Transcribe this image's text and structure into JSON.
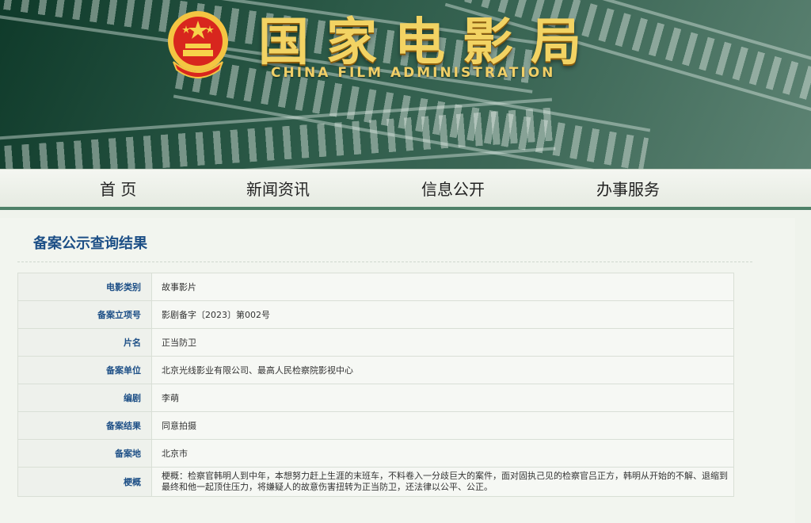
{
  "header": {
    "title": "国家电影局",
    "subtitle": "CHINA FILM ADMINISTRATION",
    "emblem": "national-emblem",
    "colors": {
      "bg_dark": "#0f3a2a",
      "bg_light": "#5d8373",
      "title_gold": "#f2d363"
    }
  },
  "nav": {
    "items": [
      {
        "label": "首 页"
      },
      {
        "label": "新闻资讯"
      },
      {
        "label": "信息公开"
      },
      {
        "label": "办事服务"
      }
    ],
    "accent": "#4e8068"
  },
  "result": {
    "title": "备案公示查询结果",
    "title_color": "#1d4f86",
    "rows": [
      {
        "label": "电影类别",
        "value": "故事影片"
      },
      {
        "label": "备案立项号",
        "value": "影剧备字〔2023〕第002号"
      },
      {
        "label": "片名",
        "value": "正当防卫"
      },
      {
        "label": "备案单位",
        "value": "北京光线影业有限公司、最高人民检察院影视中心"
      },
      {
        "label": "编剧",
        "value": "李萌"
      },
      {
        "label": "备案结果",
        "value": "同意拍摄"
      },
      {
        "label": "备案地",
        "value": "北京市"
      }
    ],
    "summary": {
      "label": "梗概",
      "text": "梗概：检察官韩明人到中年，本想努力赶上生涯的末班车，不料卷入一分歧巨大的案件，面对固执己见的检察官吕正方，韩明从开始的不解、退缩到最终和他一起顶住压力，将嫌疑人的故意伤害扭转为正当防卫，还法律以公平、公正。"
    }
  }
}
